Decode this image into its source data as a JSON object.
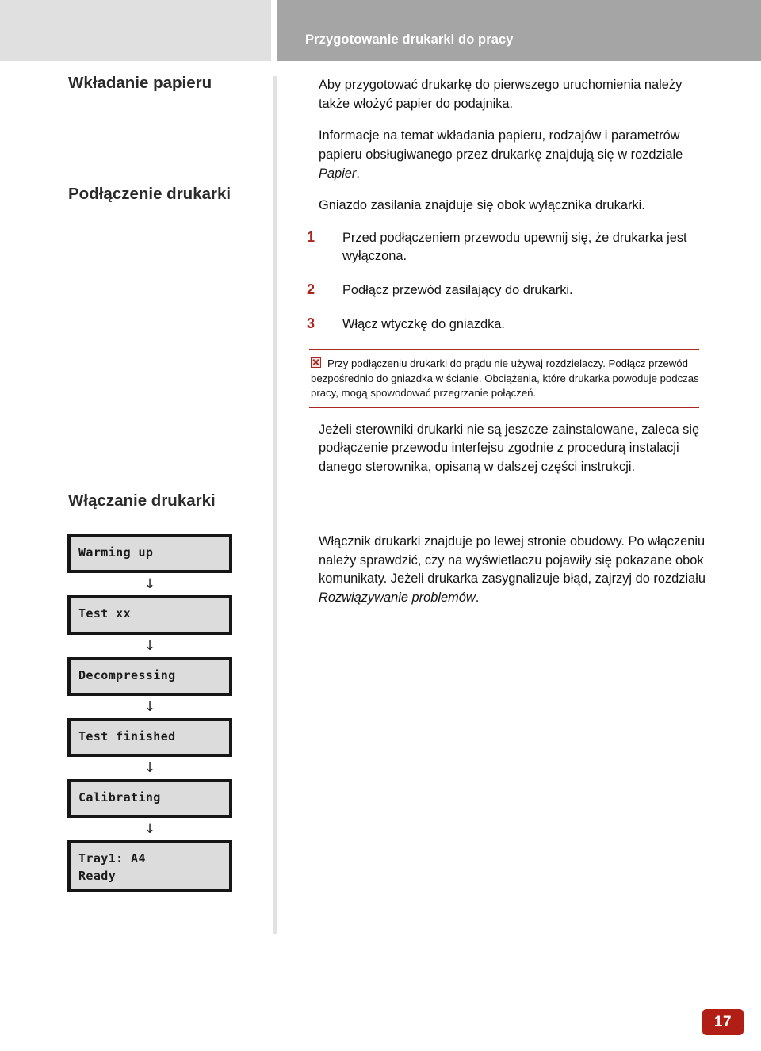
{
  "header": {
    "title": "Przygotowanie drukarki do pracy"
  },
  "sidebar": {
    "headings": [
      {
        "label": "Wkładanie papieru"
      },
      {
        "label": "Podłączenie drukarki"
      },
      {
        "label": "Włączanie drukarki"
      }
    ],
    "lcd_flow": [
      {
        "lines": "Warming up"
      },
      {
        "lines": "Test xx"
      },
      {
        "lines": "Decompressing"
      },
      {
        "lines": "Test finished"
      },
      {
        "lines": "Calibrating"
      },
      {
        "lines": "Tray1: A4\nReady"
      }
    ],
    "arrow_glyph": "↓"
  },
  "main": {
    "paragraphs": [
      "Aby przygotować drukarkę do pierwszego uruchomienia należy także włożyć papier do podajnika.",
      "Informacje na temat wkładania papieru, rodzajów i parametrów papieru obsługiwanego przez drukarkę znajdują się w rozdziale ",
      "Gniazdo zasilania znajduje się obok wyłącznika drukarki."
    ],
    "italic_refs": {
      "papier": "Papier",
      "rozwiazywanie": "Rozwiązywanie problemów"
    },
    "steps": [
      {
        "num": "1",
        "text": "Przed podłączeniem przewodu upewnij się, że drukarka jest wyłączona."
      },
      {
        "num": "2",
        "text": "Podłącz przewód zasilający do drukarki."
      },
      {
        "num": "3",
        "text": "Włącz wtyczkę do gniazdka."
      }
    ],
    "warning": {
      "icon": "broken-image-icon",
      "text": "Przy podłączeniu drukarki do prądu nie używaj rozdzielaczy. Podłącz przewód bezpośrednio do gniazdka w ścianie. Obciążenia, które drukarka powoduje podczas pracy, mogą spowodować przegrzanie połączeń."
    },
    "driver_note": "Jeżeli sterowniki drukarki nie są jeszcze zainstalowane, zaleca się podłączenie przewodu interfejsu zgodnie z procedurą instalacji danego sterownika, opisaną w dalszej części instrukcji.",
    "power_note_a": "Włącznik drukarki znajduje po lewej stronie obudowy. Po włączeniu należy sprawdzić, czy na wyświetlaczu pojawiły się pokazane obok komunikaty. Jeżeli drukarka zasygnalizuje błąd, zajrzyj do rozdziału ",
    "power_note_b": "."
  },
  "footer": {
    "page_number": "17"
  },
  "colors": {
    "header_band": "#a5a5a5",
    "header_left_block": "#e0e0e0",
    "accent_red": "#a8271e",
    "page_badge": "#b01e15",
    "lcd_fill": "#dcdcdc",
    "lcd_border": "#161616"
  }
}
